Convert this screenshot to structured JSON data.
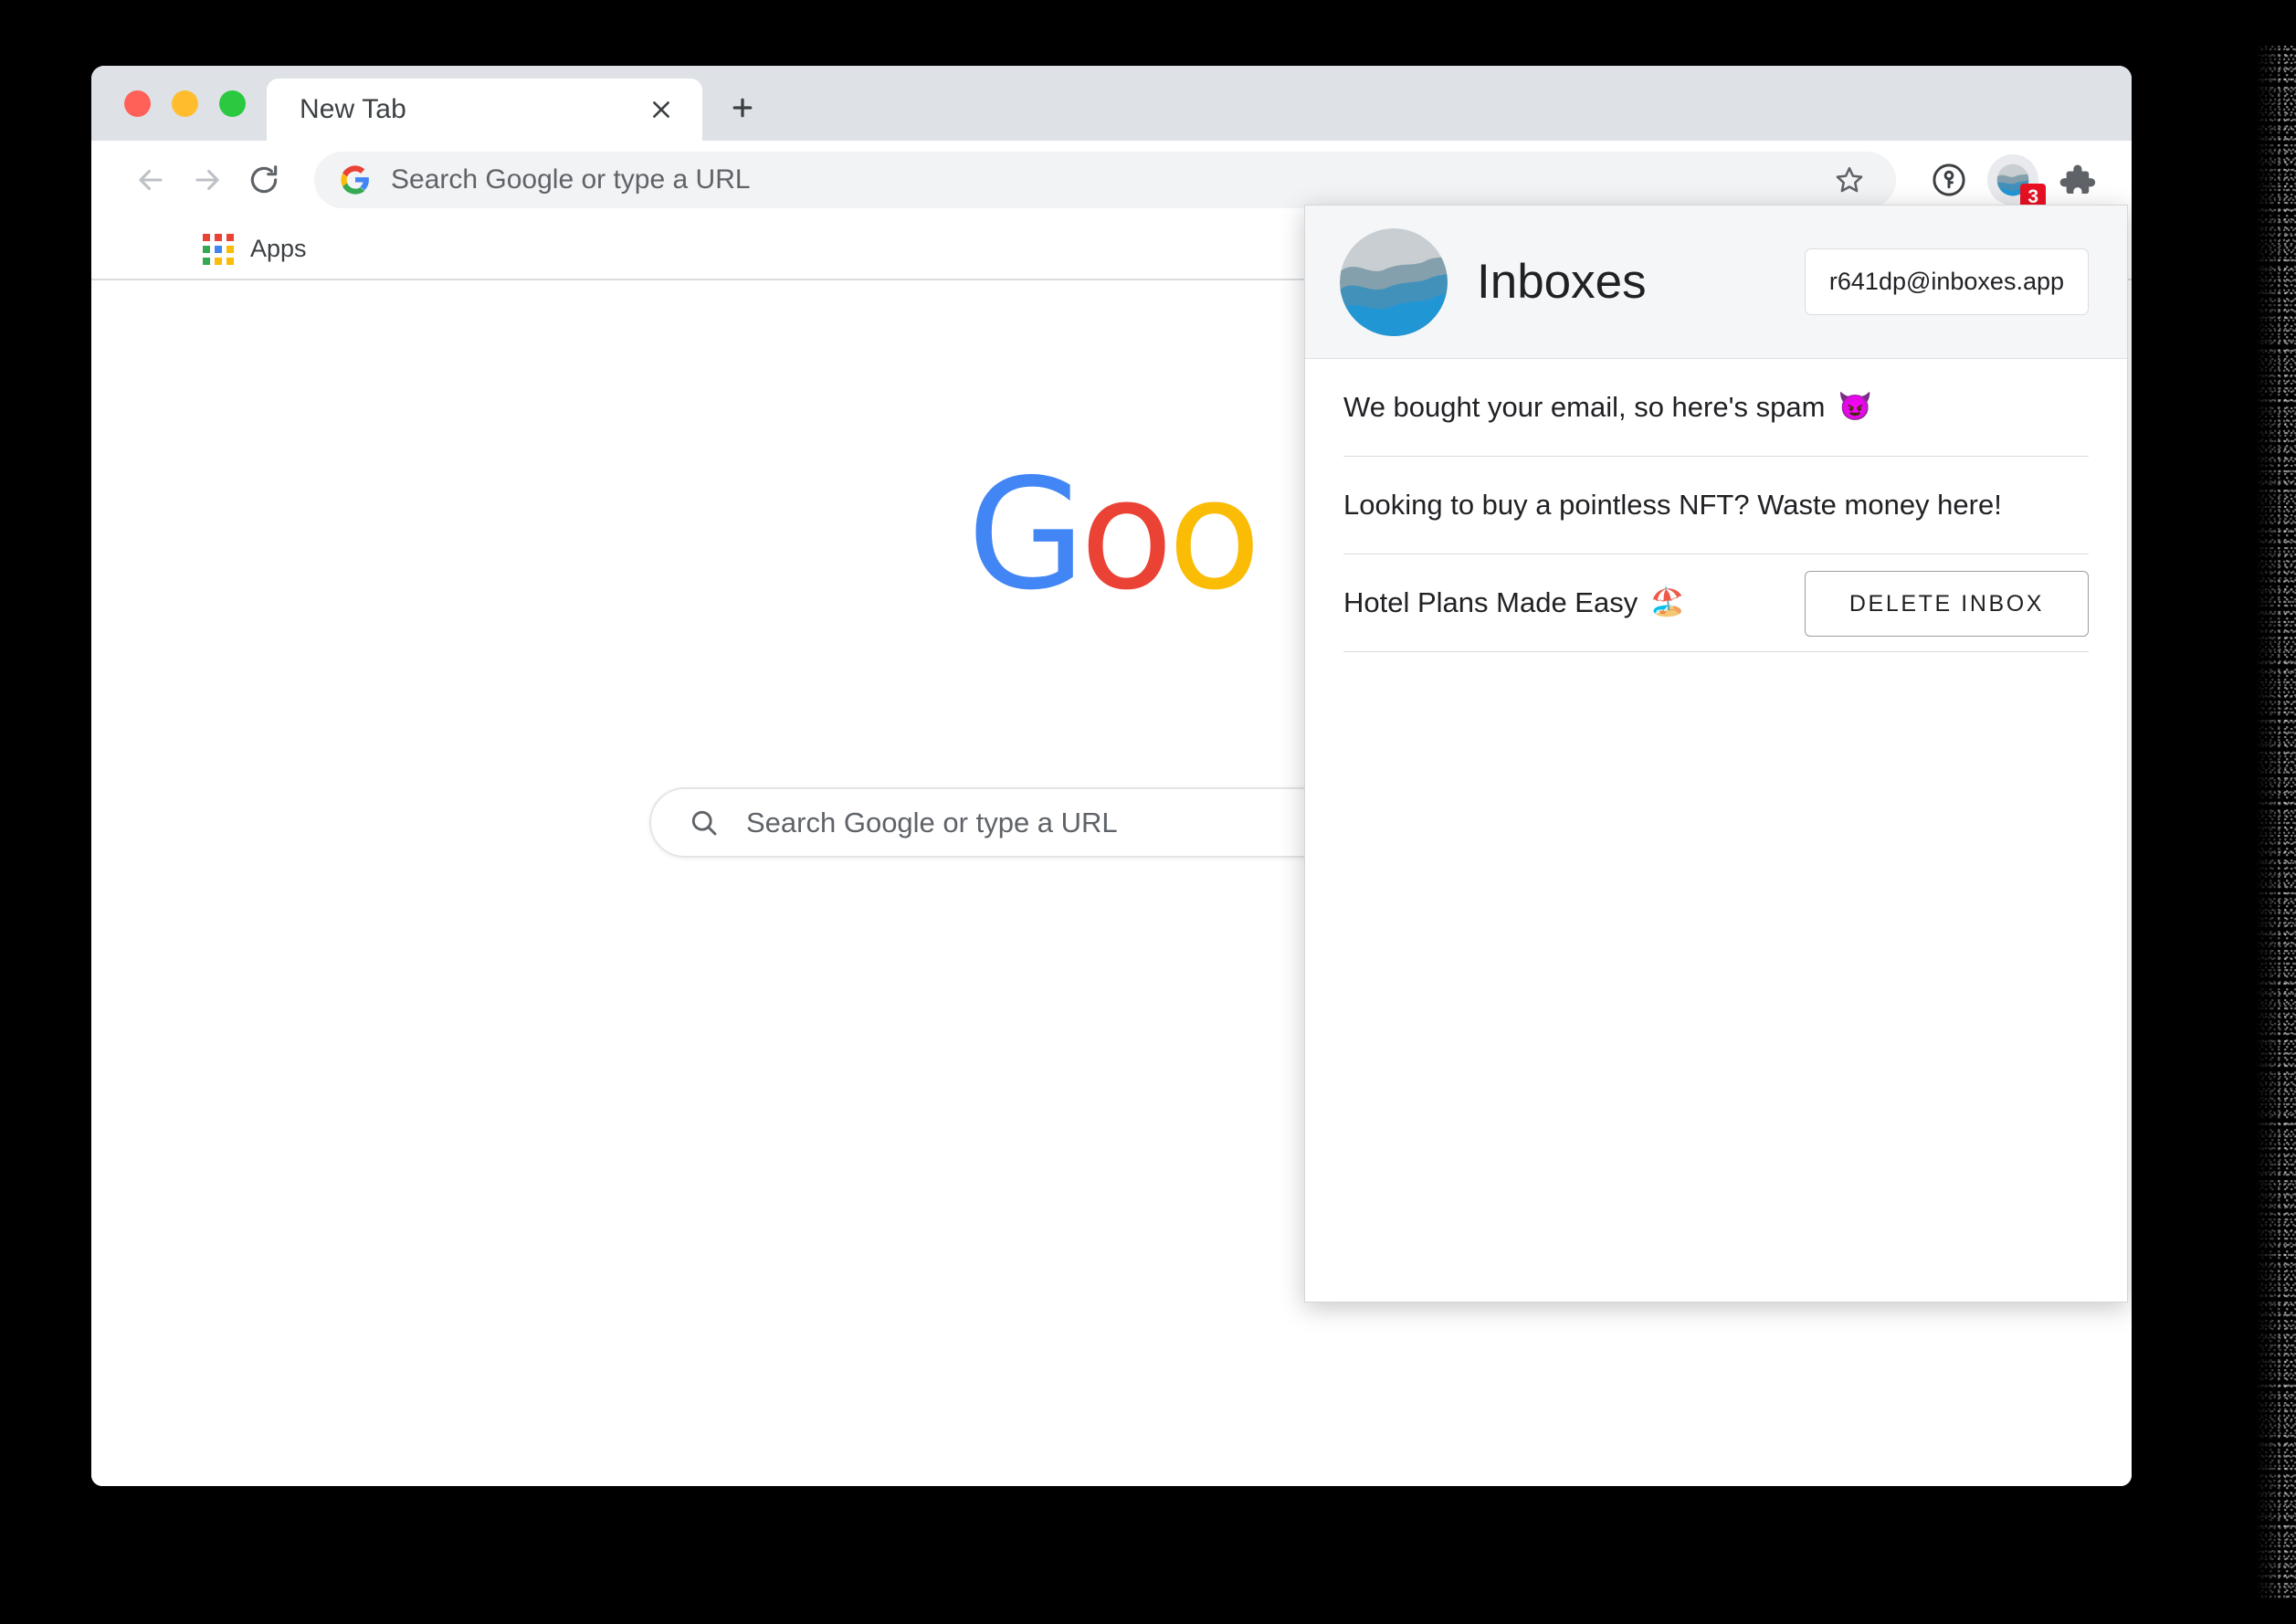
{
  "window": {
    "traffic_lights": [
      {
        "name": "close",
        "color": "#ff6159"
      },
      {
        "name": "minimize",
        "color": "#ffbd2e"
      },
      {
        "name": "zoom",
        "color": "#2ac940"
      }
    ]
  },
  "tabs": {
    "active_tab_title": "New Tab",
    "close_glyph": "×",
    "new_tab_glyph": "+"
  },
  "toolbar": {
    "back_label": "Back",
    "forward_label": "Forward",
    "reload_label": "Reload",
    "omnibox_text": "Search Google or type a URL",
    "bookmark_label": "Bookmark this tab",
    "password_manager_label": "1Password",
    "extension_label": "Inboxes",
    "extension_badge": "3",
    "extensions_label": "Extensions"
  },
  "bookmarks_bar": {
    "items": [
      {
        "label": "Apps",
        "icon": "apps-grid-icon"
      }
    ]
  },
  "new_tab_page": {
    "logo_letters": [
      {
        "char": "G",
        "color": "#4285f4"
      },
      {
        "char": "o",
        "color": "#ea4335"
      },
      {
        "char": "o",
        "color": "#fbbc05"
      }
    ],
    "search_placeholder": "Search Google or type a URL"
  },
  "popup": {
    "brand_name": "Inboxes",
    "email_address": "r641dp@inboxes.app",
    "delete_button_label": "DELETE INBOX",
    "messages": [
      {
        "subject": "We bought your email, so here's spam",
        "emoji": "😈"
      },
      {
        "subject": "Looking to buy a pointless NFT? Waste money here!",
        "emoji": ""
      },
      {
        "subject": "Hotel Plans Made Easy",
        "emoji": "🏖️"
      }
    ]
  },
  "colors": {
    "tab_strip": "#dee1e6",
    "omnibox": "#f1f3f4",
    "popup_header": "#f4f6f8",
    "badge_red": "#e81123",
    "logo_wave_1": "#c9ced2",
    "logo_wave_2": "#85a0ad",
    "logo_wave_3": "#4291bb",
    "logo_wave_4": "#2196d4"
  }
}
